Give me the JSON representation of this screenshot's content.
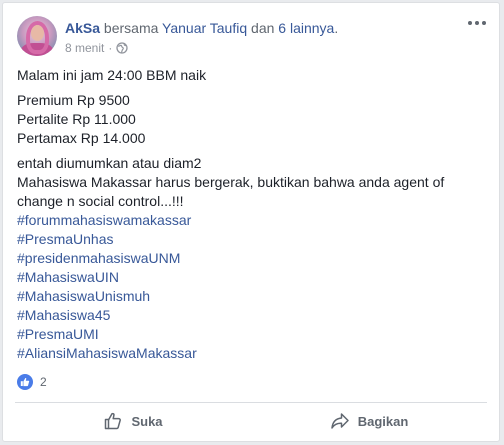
{
  "post": {
    "author": "AkSa",
    "with_text": "bersama",
    "tagged_user": "Yanuar Taufiq",
    "and_text": "dan",
    "others_link": "6 lainnya",
    "period": ".",
    "timestamp": "8 menit",
    "separator": "·",
    "privacy_icon": "globe-icon",
    "more_icon": "more-options-icon",
    "content": {
      "line1": "Malam ini jam 24:00 BBM naik",
      "prices": [
        "Premium Rp 9500",
        "Pertalite Rp 11.000",
        "Pertamax Rp 14.000"
      ],
      "line_announced": "entah diumumkan atau diam2",
      "call_to_action": "Mahasiswa Makassar harus bergerak, buktikan bahwa anda agent of change n social control...!!!",
      "hashtags": [
        "#forummahasiswamakassar",
        "#PresmaUnhas",
        "#presidenmahasiswaUNM",
        "#MahasiswaUIN",
        "#MahasiswaUnismuh",
        "#Mahasiswa45",
        "#PresmaUMI",
        "#AliansiMahasiswaMakassar"
      ]
    },
    "reactions": {
      "icon": "like-reaction-icon",
      "count": "2"
    },
    "actions": {
      "like_label": "Suka",
      "share_label": "Bagikan"
    }
  },
  "colors": {
    "link": "#385898",
    "text": "#1d2129",
    "muted": "#606770",
    "like_blue": "#4a7ce8"
  }
}
